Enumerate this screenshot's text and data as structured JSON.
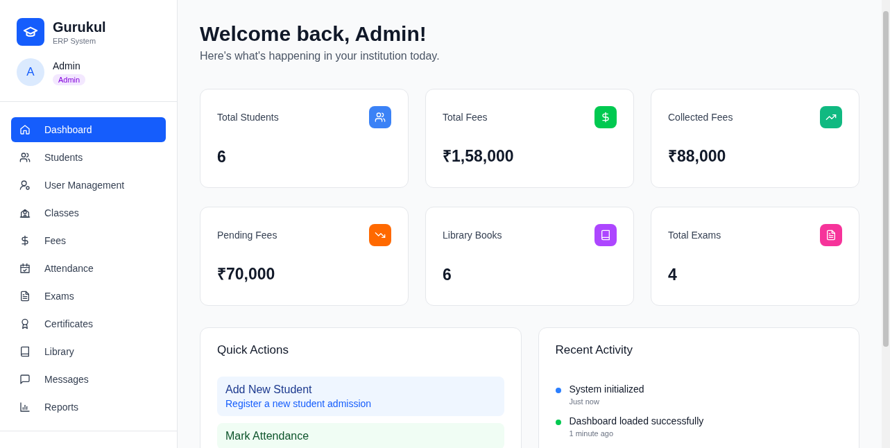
{
  "brand": {
    "name": "Gurukul",
    "subtitle": "ERP System"
  },
  "user": {
    "initial": "A",
    "name": "Admin",
    "role": "Admin"
  },
  "nav": [
    {
      "label": "Dashboard",
      "kind": "home",
      "selected": true
    },
    {
      "label": "Students",
      "kind": "users",
      "selected": false
    },
    {
      "label": "User Management",
      "kind": "user-cog",
      "selected": false
    },
    {
      "label": "Classes",
      "kind": "school",
      "selected": false
    },
    {
      "label": "Fees",
      "kind": "dollar",
      "selected": false
    },
    {
      "label": "Attendance",
      "kind": "calendar",
      "selected": false
    },
    {
      "label": "Exams",
      "kind": "file",
      "selected": false
    },
    {
      "label": "Certificates",
      "kind": "award",
      "selected": false
    },
    {
      "label": "Library",
      "kind": "book",
      "selected": false
    },
    {
      "label": "Messages",
      "kind": "message",
      "selected": false
    },
    {
      "label": "Reports",
      "kind": "chart",
      "selected": false
    }
  ],
  "header": {
    "title": "Welcome back, Admin!",
    "subtitle": "Here's what's happening in your institution today."
  },
  "stats": [
    {
      "label": "Total Students",
      "value": "6",
      "kind": "users",
      "color": "#3b82f6"
    },
    {
      "label": "Total Fees",
      "value": "₹1,58,000",
      "kind": "dollar",
      "color": "#00c950"
    },
    {
      "label": "Collected Fees",
      "value": "₹88,000",
      "kind": "trend-up",
      "color": "#10b981"
    },
    {
      "label": "Pending Fees",
      "value": "₹70,000",
      "kind": "trend-down",
      "color": "#ff6900"
    },
    {
      "label": "Library Books",
      "value": "6",
      "kind": "book",
      "color": "#ad46ff"
    },
    {
      "label": "Total Exams",
      "value": "4",
      "kind": "file",
      "color": "#f6339a"
    }
  ],
  "quick_actions": {
    "title": "Quick Actions",
    "items": [
      {
        "title": "Add New Student",
        "description": "Register a new student admission",
        "kind": "blue"
      },
      {
        "title": "Mark Attendance",
        "kind": "green"
      }
    ]
  },
  "recent_activity": {
    "title": "Recent Activity",
    "items": [
      {
        "text": "System initialized",
        "time": "Just now",
        "color": "#2b7fff"
      },
      {
        "text": "Dashboard loaded successfully",
        "time": "1 minute ago",
        "color": "#00c950"
      }
    ]
  }
}
